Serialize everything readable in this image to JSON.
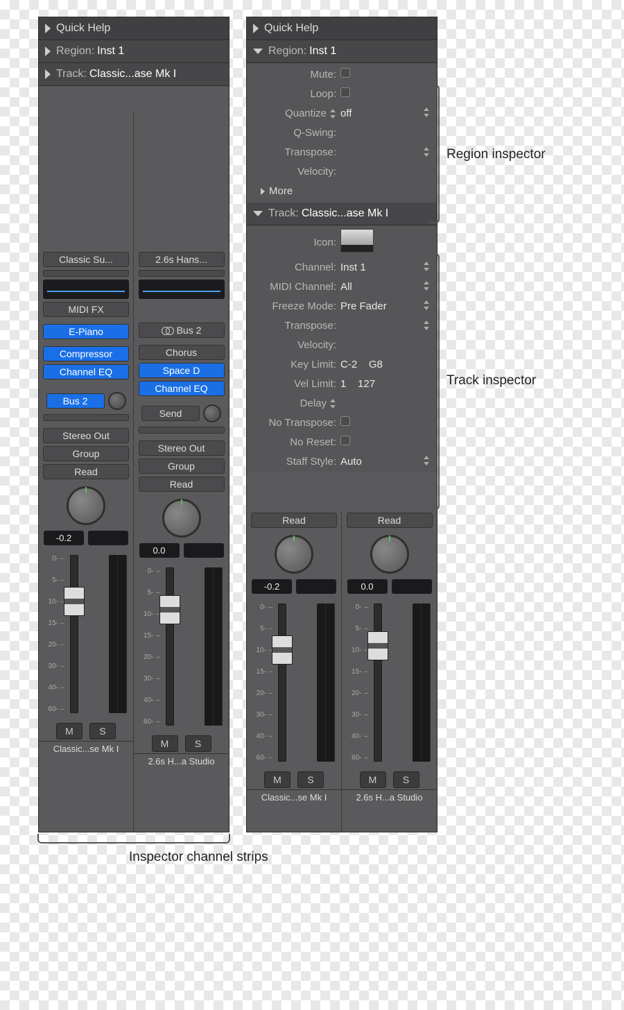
{
  "quick_help": "Quick Help",
  "region_hdr": "Region:",
  "region_val": "Inst 1",
  "track_hdr": "Track:",
  "track_val": "Classic...ase Mk I",
  "region": {
    "mute": "Mute:",
    "loop": "Loop:",
    "quantize": "Quantize",
    "quantize_val": "off",
    "qswing": "Q-Swing:",
    "transpose": "Transpose:",
    "velocity": "Velocity:",
    "more": "More"
  },
  "track": {
    "icon": "Icon:",
    "channel": "Channel:",
    "channel_v": "Inst 1",
    "midich": "MIDI Channel:",
    "midich_v": "All",
    "freeze": "Freeze Mode:",
    "freeze_v": "Pre Fader",
    "transpose": "Transpose:",
    "velocity": "Velocity:",
    "keylim": "Key Limit:",
    "keylim_v": "C-2    G8",
    "vellim": "Vel Limit:",
    "vellim_v": "1    127",
    "delay": "Delay",
    "notrans": "No Transpose:",
    "noreset": "No Reset:",
    "staff": "Staff Style:",
    "staff_v": "Auto"
  },
  "stripA": {
    "preset": "Classic Su...",
    "midifx": "MIDI FX",
    "inst": "E-Piano",
    "fx": [
      "Compressor",
      "Channel EQ"
    ],
    "send": "Bus 2",
    "out": "Stereo Out",
    "group": "Group",
    "auto": "Read",
    "db": "-0.2",
    "name": "Classic...se Mk I"
  },
  "stripB": {
    "preset": "2.6s Hans...",
    "in": "Bus 2",
    "fx": [
      "Chorus",
      "Space D",
      "Channel EQ"
    ],
    "send": "Send",
    "out": "Stereo Out",
    "group": "Group",
    "auto": "Read",
    "db": "0.0",
    "name": "2.6s H...a Studio"
  },
  "scale": [
    "0-",
    "5-",
    "10-",
    "15-",
    "20-",
    "30-",
    "40-",
    "60-"
  ],
  "mute": "M",
  "solo": "S",
  "call_region": "Region inspector",
  "call_track": "Track inspector",
  "call_strips": "Inspector channel strips"
}
